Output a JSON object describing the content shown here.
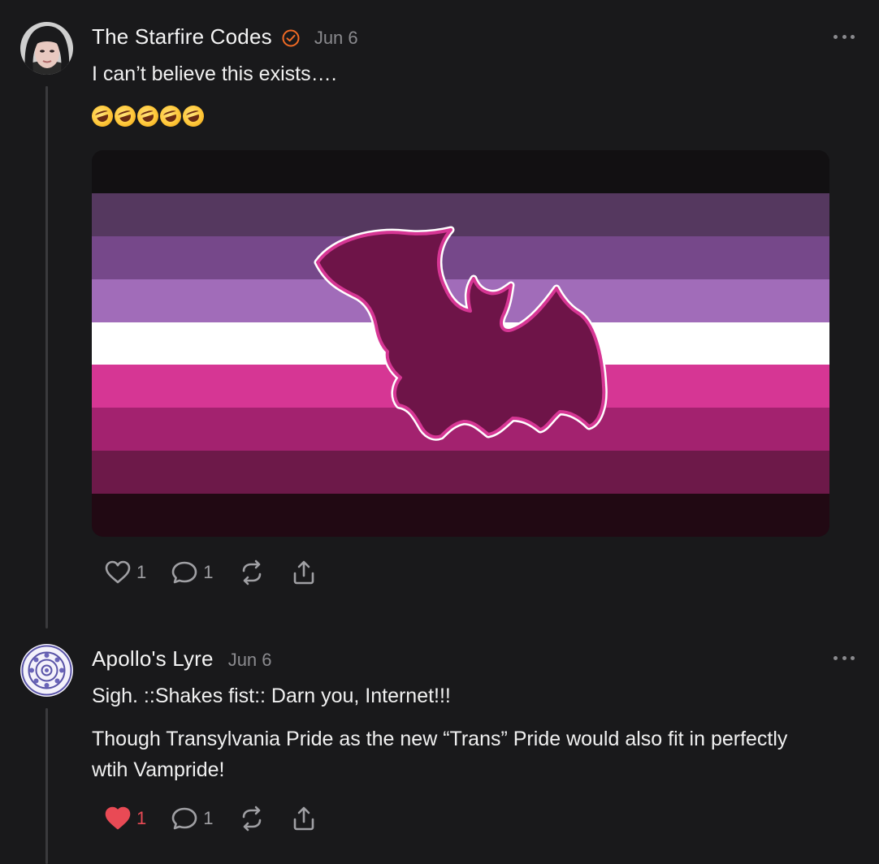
{
  "posts": [
    {
      "author": "The Starfire Codes",
      "verified": true,
      "date": "Jun 6",
      "text": "I can’t believe this exists….",
      "emoji_count": 5,
      "image_alt": "Vampire pride flag with bat",
      "flag_colors": [
        "#121012",
        "#55385f",
        "#76488a",
        "#a16cb9",
        "#ffffff",
        "#d63694",
        "#a3226f",
        "#6d1949",
        "#210913"
      ],
      "actions": {
        "likes": "1",
        "replies": "1",
        "liked": false
      }
    },
    {
      "author": "Apollo's Lyre",
      "verified": false,
      "date": "Jun 6",
      "text": "Sigh. ::Shakes fist:: Darn you, Internet!!!",
      "text2": "Though Transylvania Pride as the new “Trans” Pride would also fit in perfectly wtih Vampride!",
      "actions": {
        "likes": "1",
        "replies": "1",
        "liked": true
      }
    }
  ],
  "colors": {
    "background": "#19191b",
    "verified_accent": "#f06a24",
    "like_active": "#e94a55",
    "muted": "#8a8a8e"
  }
}
